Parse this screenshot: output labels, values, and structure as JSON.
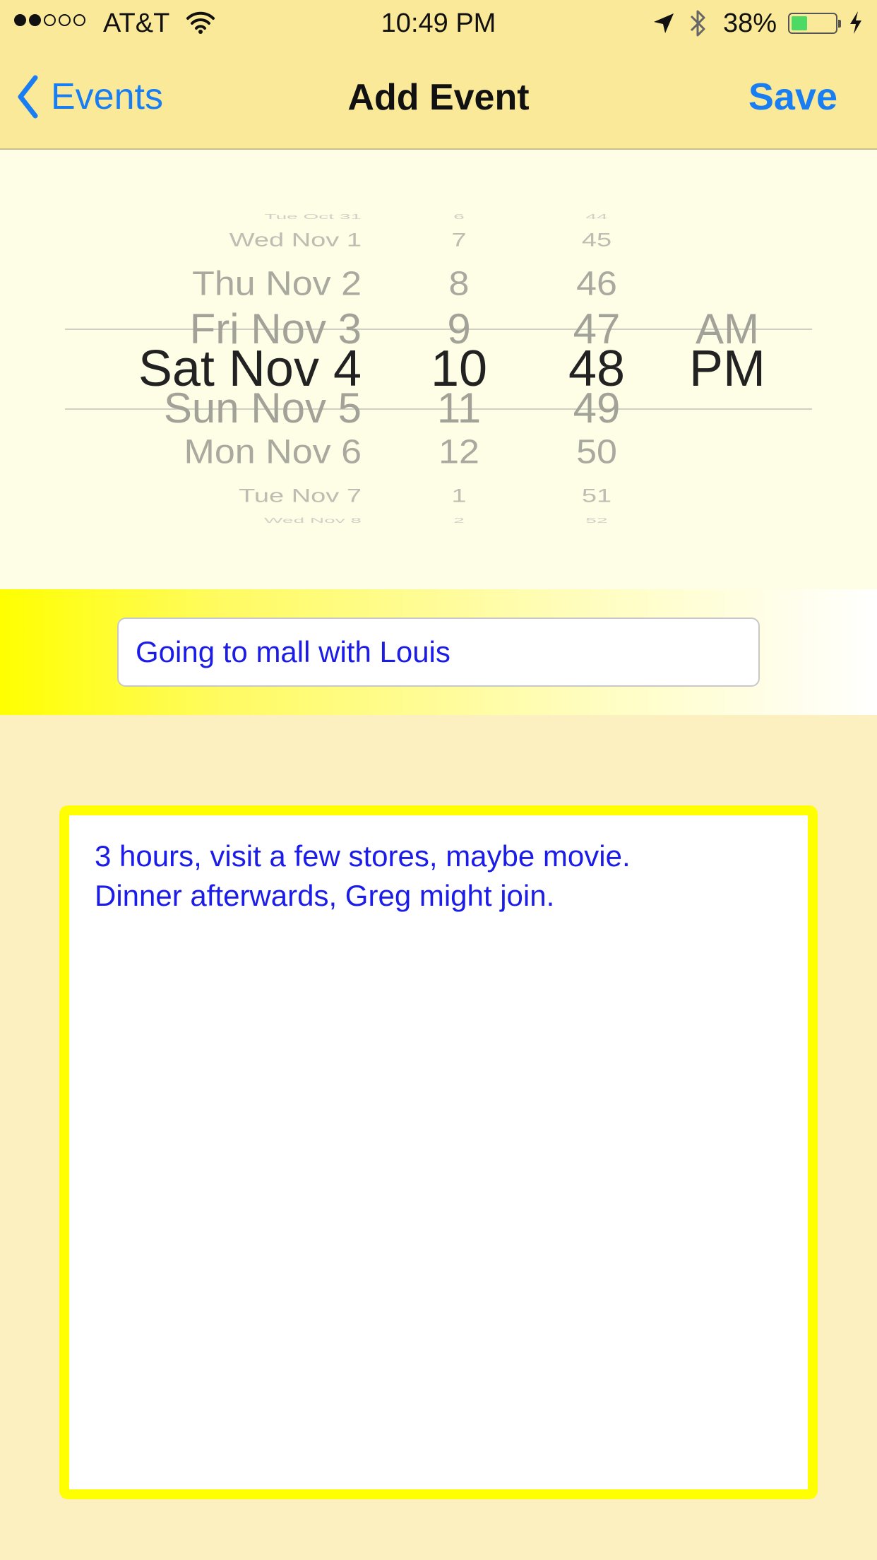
{
  "status_bar": {
    "carrier": "AT&T",
    "time": "10:49 PM",
    "battery_percent": "38%",
    "battery_level": 0.38,
    "signal_bars_filled": 2,
    "signal_bars_total": 5
  },
  "nav": {
    "back_label": "Events",
    "title": "Add Event",
    "save_label": "Save"
  },
  "picker": {
    "selected": {
      "date": "Sat Nov 4",
      "hour": "10",
      "minute": "48",
      "ampm": "PM"
    },
    "rows_above": [
      {
        "date": "Tue Oct 31",
        "hour": "6",
        "minute": "44",
        "ampm": ""
      },
      {
        "date": "Wed Nov 1",
        "hour": "7",
        "minute": "45",
        "ampm": ""
      },
      {
        "date": "Thu Nov 2",
        "hour": "8",
        "minute": "46",
        "ampm": ""
      },
      {
        "date": "Fri Nov 3",
        "hour": "9",
        "minute": "47",
        "ampm": "AM"
      }
    ],
    "rows_below": [
      {
        "date": "Sun Nov 5",
        "hour": "11",
        "minute": "49",
        "ampm": ""
      },
      {
        "date": "Mon Nov 6",
        "hour": "12",
        "minute": "50",
        "ampm": ""
      },
      {
        "date": "Tue Nov 7",
        "hour": "1",
        "minute": "51",
        "ampm": ""
      },
      {
        "date": "Wed Nov 8",
        "hour": "2",
        "minute": "52",
        "ampm": ""
      }
    ]
  },
  "title_field": {
    "value": "Going to mall with Louis"
  },
  "notes": {
    "lines": [
      "3 hours, visit a few stores, maybe movie.",
      "Dinner afterwards, Greg might join."
    ]
  },
  "colors": {
    "bar_background": "#fbe99a",
    "accent_blue": "#1a7ef3",
    "text_blue": "#1c1ce8",
    "yellow": "#ffff00",
    "page_background": "#fcefc0"
  }
}
